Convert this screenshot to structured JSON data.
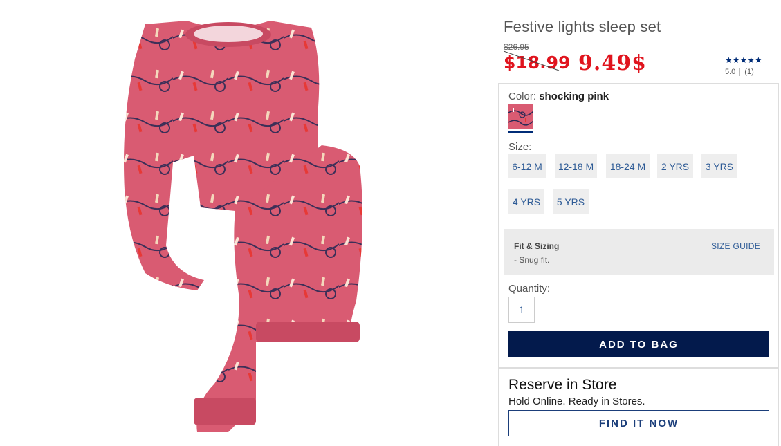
{
  "product": {
    "title": "Festive lights sleep set",
    "original_price": "$26.95",
    "sale_price": "$18.99",
    "promo_price": "9.49$",
    "image_alt_color": "shocking pink"
  },
  "rating": {
    "stars": "★★★★★",
    "score": "5.0",
    "count": "(1)"
  },
  "color": {
    "label": "Color:",
    "value": "shocking pink",
    "swatch_hex": "#d95b72"
  },
  "size": {
    "label": "Size:",
    "options": [
      "6-12 M",
      "12-18 M",
      "18-24 M",
      "2 YRS",
      "3 YRS",
      "4 YRS",
      "5 YRS"
    ]
  },
  "fit": {
    "title": "Fit & Sizing",
    "note": "- Snug fit.",
    "guide_link": "SIZE GUIDE"
  },
  "quantity": {
    "label": "Quantity:",
    "value": "1"
  },
  "actions": {
    "add_to_bag": "ADD TO BAG",
    "reserve_title": "Reserve in Store",
    "reserve_subtitle": "Hold Online. Ready in Stores.",
    "find_it_now": "FIND IT NOW"
  },
  "colors": {
    "sale_red": "#e0141e",
    "navy": "#031a4c",
    "link_blue": "#2e5b96",
    "garment_pink": "#d95b72"
  }
}
